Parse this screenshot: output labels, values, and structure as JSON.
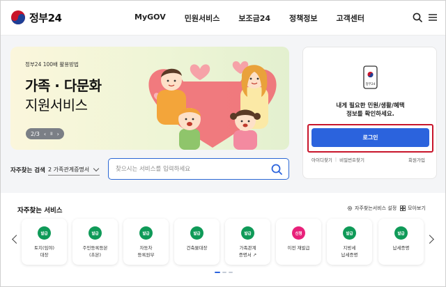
{
  "header": {
    "logo_text": "정부24",
    "nav": [
      "MyGOV",
      "민원서비스",
      "보조금24",
      "정책정보",
      "고객센터"
    ],
    "search_icon": "search-icon",
    "menu_icon": "hamburger-menu-icon"
  },
  "banner": {
    "subtitle": "정부24 100배 활용방법",
    "title_line1": "가족 · 다문화",
    "title_line2": "지원서비스",
    "pager": "2/3",
    "pager_prev": "‹",
    "pager_pause": "II",
    "pager_next": "›"
  },
  "search": {
    "label": "자주찾는 검색",
    "select_value": "2 가족관계증명서",
    "placeholder": "찾으시는 서비스를 입력하세요"
  },
  "login": {
    "phone_label": "정부24",
    "message_line1": "내게 필요한 민원/생활/혜택",
    "message_line2": "정보를 확인하세요.",
    "button": "로그인",
    "find_id": "아이디찾기",
    "find_pw": "비밀번호찾기",
    "join": "회원가입",
    "highlight_color": "#c8142a",
    "button_color": "#2b63dd"
  },
  "services": {
    "title": "자주찾는 서비스",
    "setting": "자주찾는서비스 설정",
    "more": "모아보기",
    "items": [
      {
        "badge": "발급",
        "color": "#0f9a58",
        "line1": "토지(임야)",
        "line2": "대장"
      },
      {
        "badge": "발급",
        "color": "#0f9a58",
        "line1": "주민등록등본",
        "line2": "(초본)"
      },
      {
        "badge": "발급",
        "color": "#0f9a58",
        "line1": "자동차",
        "line2": "등록원부"
      },
      {
        "badge": "발급",
        "color": "#0f9a58",
        "line1": "건축물대장",
        "line2": ""
      },
      {
        "badge": "발급",
        "color": "#0f9a58",
        "line1": "가족관계",
        "line2": "증명서 ↗"
      },
      {
        "badge": "신청",
        "color": "#e8217a",
        "line1": "이전 재발급",
        "line2": ""
      },
      {
        "badge": "발급",
        "color": "#0f9a58",
        "line1": "지방세",
        "line2": "납세증명"
      },
      {
        "badge": "발급",
        "color": "#0f9a58",
        "line1": "납세증명",
        "line2": ""
      }
    ]
  }
}
